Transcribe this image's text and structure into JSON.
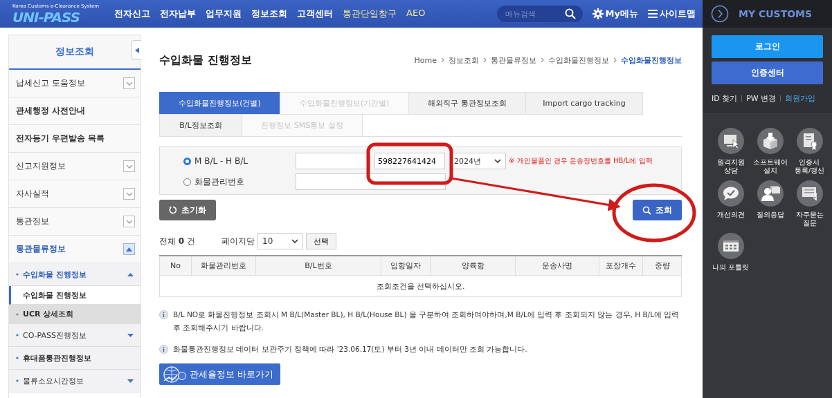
{
  "header": {
    "logo": "UNI-PASS",
    "logo_tagline": "Korea Customs e-Clearance System",
    "nav": [
      {
        "label": "전자신고",
        "highlighted": false
      },
      {
        "label": "전자납부",
        "highlighted": false
      },
      {
        "label": "업무지원",
        "highlighted": false
      },
      {
        "label": "정보조회",
        "highlighted": false
      },
      {
        "label": "고객센터",
        "highlighted": false
      },
      {
        "label": "통관단일창구",
        "highlighted": true
      },
      {
        "label": "AEO",
        "highlighted": true
      }
    ],
    "search": {
      "placeholder": "메뉴검색"
    },
    "my_menu": "My메뉴",
    "sitemap": "사이트맵"
  },
  "sidebar": {
    "title": "정보조회",
    "items": [
      {
        "label": "납세신고 도움정보",
        "kind": "toggle",
        "expanded": false
      },
      {
        "label": "관세행정 사전안내",
        "kind": "link"
      },
      {
        "label": "전자등기 우편발송 목록",
        "kind": "link"
      },
      {
        "label": "신고지원정보",
        "kind": "toggle",
        "expanded": false
      },
      {
        "label": "자사실적",
        "kind": "toggle",
        "expanded": false
      },
      {
        "label": "통관정보",
        "kind": "toggle",
        "expanded": false
      },
      {
        "label": "통관물류정보",
        "kind": "toggle",
        "expanded": true
      }
    ],
    "subitems": [
      {
        "label": "수입화물 진행정보",
        "kind": "group",
        "expanded": true,
        "children": [
          {
            "label": "수입화물 진행정보",
            "selected": true
          }
        ]
      },
      {
        "label": "UCR 상세조회",
        "kind": "leaf",
        "hovered": true
      },
      {
        "label": "CO-PASS진행정보",
        "kind": "group",
        "expanded": false
      },
      {
        "label": "휴대품통관진행정보",
        "kind": "leaf",
        "hovered": false
      },
      {
        "label": "물류소요시간정보",
        "kind": "group",
        "expanded": false
      }
    ]
  },
  "page_title": "수입화물 진행정보",
  "breadcrumb": [
    "Home",
    "정보조회",
    "통관물류정보",
    "수입화물진행정보",
    "수입화물진행정보"
  ],
  "tabs": [
    [
      {
        "label": "수입화물진행정보(건별)",
        "selected": true,
        "disabled": false
      },
      {
        "label": "수입화물진행정보(기간별)",
        "selected": false,
        "disabled": true
      },
      {
        "label": "해외직구 통관정보조회",
        "selected": false,
        "disabled": false
      },
      {
        "label": "Import cargo tracking",
        "selected": false,
        "disabled": false
      }
    ],
    [
      {
        "label": "B/L정보조회",
        "selected": false,
        "disabled": false
      },
      {
        "label": "진행정보 SMS통보 설정",
        "selected": false,
        "disabled": true
      }
    ]
  ],
  "search_form": {
    "options": [
      {
        "label": "M B/L - H B/L",
        "selected": true
      },
      {
        "label": "화물관리번호",
        "selected": false
      }
    ],
    "hbl_value": "598227641424",
    "year": "2024년",
    "note": "※ 개인물품인 경우 운송장번호를 HB/L에 입력"
  },
  "reset_button": "초기화",
  "search_button": "조회",
  "results": {
    "total_label": "전체",
    "total": "0",
    "unit": "건",
    "per_page_label": "페이지당",
    "per_page": "10",
    "apply_button": "선택"
  },
  "table": {
    "columns": [
      "No",
      "화물관리번호",
      "B/L번호",
      "입항일자",
      "양륙항",
      "운송사명",
      "포장개수",
      "중량"
    ],
    "empty_message": "조회조건을 선택하십시오."
  },
  "notes": [
    "B/L NO로 화물진행정보 조회시 M B/L(Master BL), H B/L(House BL) 을 구분하여 조회하여야하며,M B/L에 입력 후 조회되지 않는 경우, H B/L에 입력 후 조회해주시기 바랍니다.",
    "화물통관진행정보 데이터 보관주기 정책에 따라 '23.06.17(토) 부터 3년 이내 데이터만 조회 가능합니다."
  ],
  "tariff_button": "관세율정보 바로가기",
  "my_customs": {
    "title": "MY CUSTOMS",
    "login": "로그인",
    "cert_center": "인증센터",
    "links": [
      {
        "label": "ID 찾기",
        "highlighted": false
      },
      {
        "label": "PW 변경",
        "highlighted": false
      },
      {
        "label": "회원가입",
        "highlighted": true
      }
    ],
    "shortcuts": [
      "원격지원\n상담",
      "소프트웨어\n설치",
      "인증서\n등록/갱신",
      "개선의견",
      "질의응답",
      "자주묻는\n질문",
      "나의 포틀릿"
    ]
  }
}
